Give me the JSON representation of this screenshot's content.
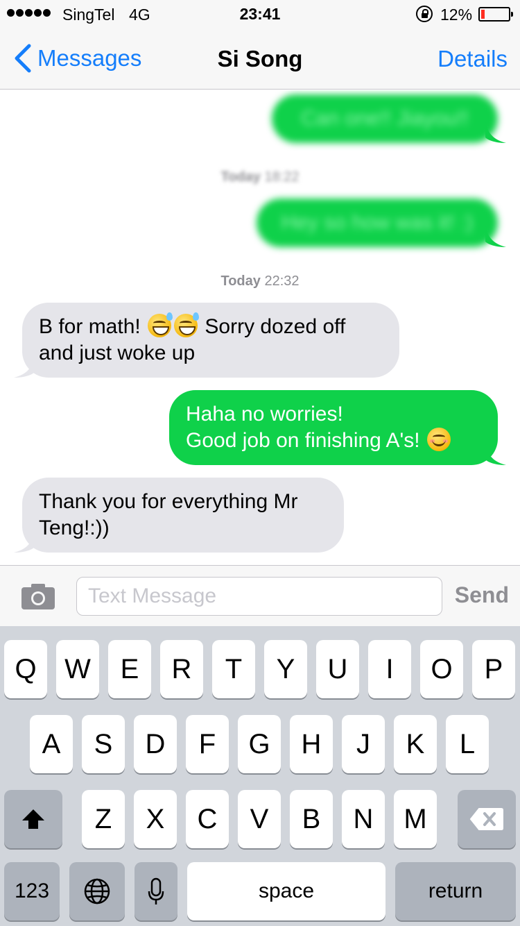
{
  "status_bar": {
    "carrier": "SingTel",
    "network": "4G",
    "time": "23:41",
    "battery_percent": "12%",
    "battery_level": 0.12,
    "signal_icon": "signal-dots-icon",
    "lock_icon": "orientation-lock-icon",
    "battery_icon": "battery-icon"
  },
  "nav": {
    "back_label": "Messages",
    "title": "Si Song",
    "details_label": "Details",
    "back_icon": "chevron-left-icon"
  },
  "thread": {
    "messages": [
      {
        "direction": "out",
        "text": "Can one!! Jiayou!!",
        "obscured": true
      },
      {
        "type": "timestamp",
        "day": "Today",
        "time": "18:22",
        "obscured": true
      },
      {
        "direction": "out",
        "text": "Hey so how was it! :)",
        "obscured": true
      },
      {
        "type": "timestamp",
        "day": "Today",
        "time": "22:32"
      },
      {
        "direction": "in",
        "text_before": "B for math!",
        "emoji": [
          "grinning-face-with-sweat",
          "grinning-face-with-sweat"
        ],
        "text_after": "Sorry dozed off",
        "line2": "and just woke up"
      },
      {
        "direction": "out",
        "line1": "Haha no worries!",
        "line2": "Good job on finishing A's!",
        "emoji": "smiling-face-with-smiling-eyes"
      },
      {
        "direction": "in",
        "line1": "Thank you for everything Mr",
        "line2": "Teng!:))"
      }
    ]
  },
  "composer": {
    "camera_icon": "camera-icon",
    "placeholder": "Text Message",
    "value": "",
    "send_label": "Send"
  },
  "keyboard": {
    "row1": [
      "Q",
      "W",
      "E",
      "R",
      "T",
      "Y",
      "U",
      "I",
      "O",
      "P"
    ],
    "row2": [
      "A",
      "S",
      "D",
      "F",
      "G",
      "H",
      "J",
      "K",
      "L"
    ],
    "row3": [
      "Z",
      "X",
      "C",
      "V",
      "B",
      "N",
      "M"
    ],
    "shift_icon": "shift-icon",
    "delete_icon": "backspace-icon",
    "numbers_label": "123",
    "globe_icon": "globe-icon",
    "mic_icon": "microphone-icon",
    "space_label": "space",
    "return_label": "return"
  },
  "colors": {
    "accent": "#157efb",
    "outgoing_bubble": "#0fd14a",
    "incoming_bubble": "#e5e5ea",
    "keyboard_bg": "#d1d5db"
  }
}
